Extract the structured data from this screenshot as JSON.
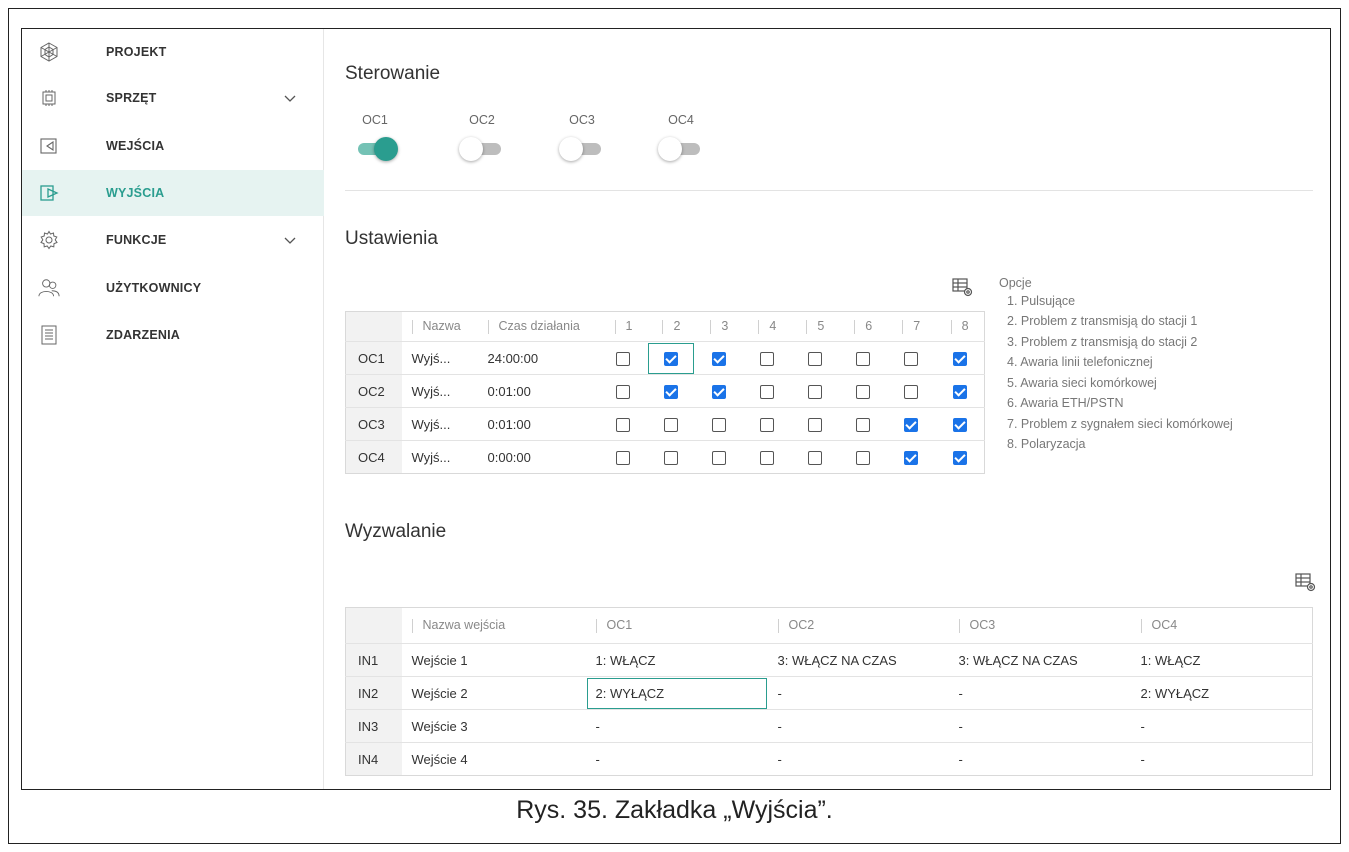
{
  "sidebar": {
    "items": [
      {
        "label": "PROJEKT",
        "icon": "project-icon"
      },
      {
        "label": "SPRZĘT",
        "icon": "hardware-icon"
      },
      {
        "label": "WEJŚCIA",
        "icon": "inputs-icon"
      },
      {
        "label": "WYJŚCIA",
        "icon": "outputs-icon"
      },
      {
        "label": "FUNKCJE",
        "icon": "functions-gear-icon"
      },
      {
        "label": "UŻYTKOWNICY",
        "icon": "users-icon"
      },
      {
        "label": "ZDARZENIA",
        "icon": "events-icon"
      }
    ],
    "active": "WYJŚCIA"
  },
  "control": {
    "title": "Sterowanie",
    "toggles": [
      {
        "label": "OC1",
        "on": true
      },
      {
        "label": "OC2",
        "on": false
      },
      {
        "label": "OC3",
        "on": false
      },
      {
        "label": "OC4",
        "on": false
      }
    ]
  },
  "settings": {
    "title": "Ustawienia",
    "headers": {
      "name": "Nazwa",
      "time": "Czas działania",
      "options": [
        "1",
        "2",
        "3",
        "4",
        "5",
        "6",
        "7",
        "8"
      ]
    },
    "rows": [
      {
        "id": "OC1",
        "name": "Wyjś...",
        "time": "24:00:00",
        "checks": [
          false,
          true,
          true,
          false,
          false,
          false,
          false,
          true
        ]
      },
      {
        "id": "OC2",
        "name": "Wyjś...",
        "time": "0:01:00",
        "checks": [
          false,
          true,
          true,
          false,
          false,
          false,
          false,
          true
        ]
      },
      {
        "id": "OC3",
        "name": "Wyjś...",
        "time": "0:01:00",
        "checks": [
          false,
          false,
          false,
          false,
          false,
          false,
          true,
          true
        ]
      },
      {
        "id": "OC4",
        "name": "Wyjś...",
        "time": "0:00:00",
        "checks": [
          false,
          false,
          false,
          false,
          false,
          false,
          true,
          true
        ]
      }
    ],
    "options_legend": {
      "title": "Opcje",
      "items": [
        "1. Pulsujące",
        "2. Problem z transmisją do stacji 1",
        "3. Problem z transmisją do stacji 2",
        "4. Awaria linii telefonicznej",
        "5. Awaria sieci komórkowej",
        "6. Awaria ETH/PSTN",
        "7. Problem z sygnałem sieci komórkowej",
        "8. Polaryzacja"
      ]
    }
  },
  "trigger": {
    "title": "Wyzwalanie",
    "headers": [
      "Nazwa wejścia",
      "OC1",
      "OC2",
      "OC3",
      "OC4"
    ],
    "rows": [
      {
        "id": "IN1",
        "name": "Wejście 1",
        "cells": [
          "1: WŁĄCZ",
          "3: WŁĄCZ NA CZAS",
          "3: WŁĄCZ NA CZAS",
          "1: WŁĄCZ"
        ]
      },
      {
        "id": "IN2",
        "name": "Wejście 2",
        "cells": [
          "2: WYŁĄCZ",
          "-",
          "-",
          "2: WYŁĄCZ"
        ]
      },
      {
        "id": "IN3",
        "name": "Wejście 3",
        "cells": [
          "-",
          "-",
          "-",
          "-"
        ]
      },
      {
        "id": "IN4",
        "name": "Wejście 4",
        "cells": [
          "-",
          "-",
          "-",
          "-"
        ]
      }
    ]
  },
  "caption": "Rys. 35. Zakładka „Wyjścia”.",
  "colors": {
    "accent": "#2a9d8f",
    "checkbox": "#1a73e8",
    "active_bg": "#e6f3f1"
  }
}
